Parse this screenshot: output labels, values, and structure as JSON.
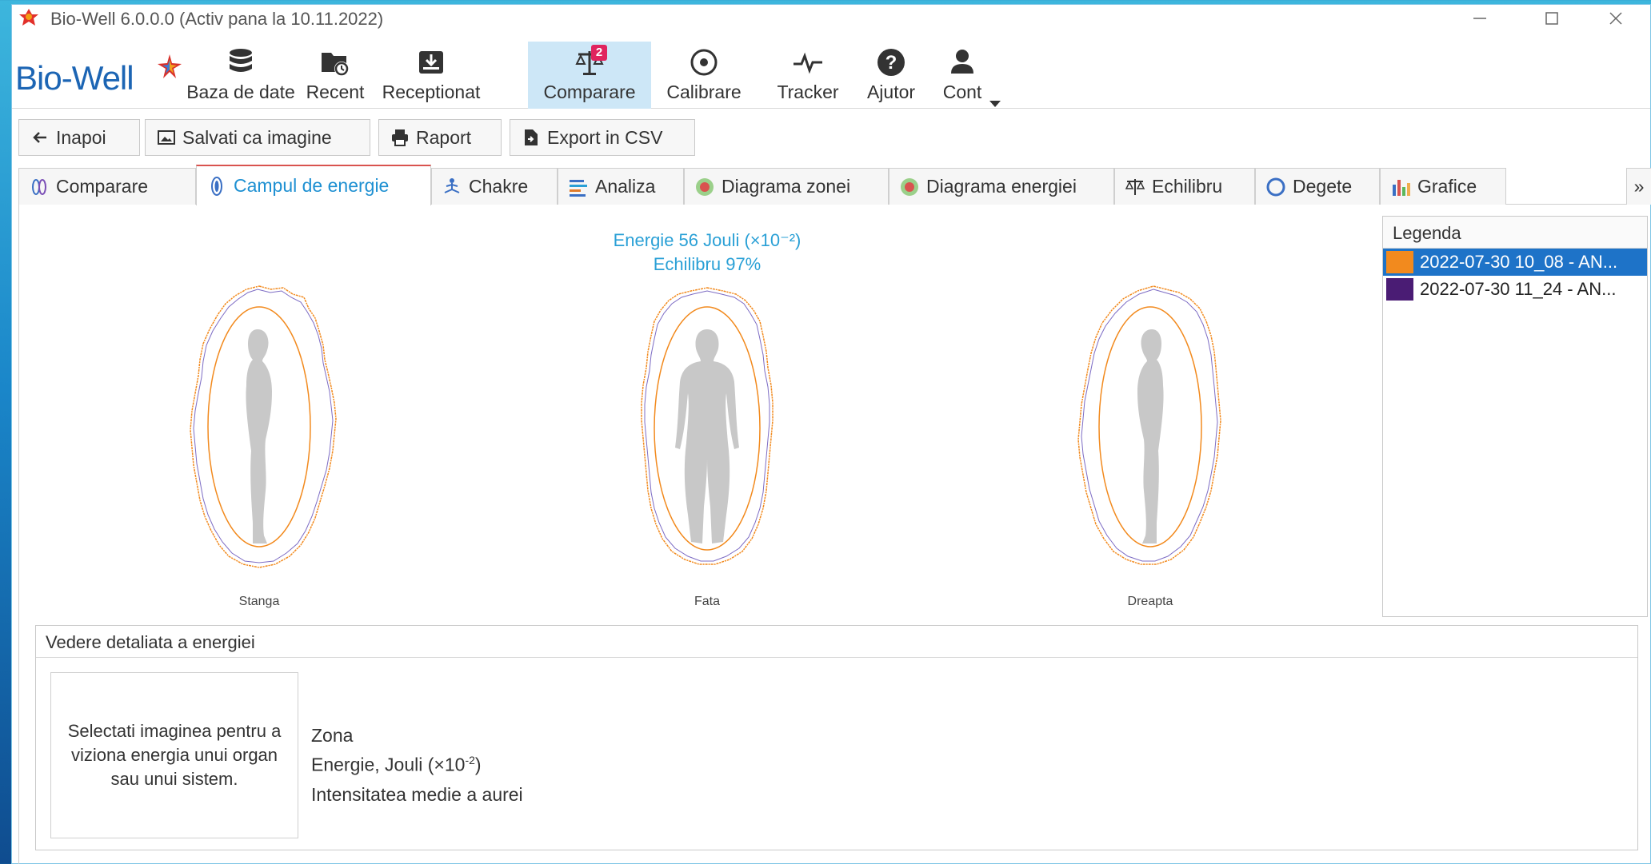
{
  "window": {
    "title": "Bio-Well 6.0.0.0 (Activ pana la 10.11.2022)"
  },
  "logo": {
    "text": "Bio-Well"
  },
  "toolbar": {
    "items": [
      {
        "label": "Baza de date",
        "icon": "database-icon"
      },
      {
        "label": "Recent",
        "icon": "folder-clock-icon"
      },
      {
        "label": "Receptionat",
        "icon": "inbox-download-icon"
      },
      {
        "label": "Comparare",
        "icon": "scales-icon",
        "badge": "2",
        "active": true
      },
      {
        "label": "Calibrare",
        "icon": "target-icon"
      },
      {
        "label": "Tracker",
        "icon": "pulse-icon"
      },
      {
        "label": "Ajutor",
        "icon": "help-icon"
      },
      {
        "label": "Cont",
        "icon": "user-icon"
      }
    ]
  },
  "actions": {
    "back": "Inapoi",
    "save_image": "Salvati ca imagine",
    "report": "Raport",
    "export_csv": "Export in CSV"
  },
  "tabs": [
    {
      "label": "Comparare"
    },
    {
      "label": "Campul de energie",
      "active": true
    },
    {
      "label": "Chakre"
    },
    {
      "label": "Analiza"
    },
    {
      "label": "Diagrama zonei"
    },
    {
      "label": "Diagrama energiei"
    },
    {
      "label": "Echilibru"
    },
    {
      "label": "Degete"
    },
    {
      "label": "Grafice"
    }
  ],
  "tab_overflow": "»",
  "energy": {
    "line1": "Energie 56 Jouli (×10⁻²)",
    "line2": "Echilibru 97%"
  },
  "views": {
    "left": "Stanga",
    "front": "Fata",
    "right": "Dreapta"
  },
  "legend": {
    "title": "Legenda",
    "items": [
      {
        "label": "2022-07-30 10_08 - AN...",
        "color": "#f28a1e"
      },
      {
        "label": "2022-07-30 11_24 - AN...",
        "color": "#4a1c74"
      }
    ]
  },
  "detail": {
    "title": "Vedere detaliata a energiei",
    "select_hint": "Selectati imaginea pentru a viziona energia unui organ sau unui sistem.",
    "zona": "Zona",
    "energie": "Energie, Jouli (×10",
    "energie_exp": "-2",
    "energie_close": ")",
    "intensitate": "Intensitatea medie a aurei"
  },
  "colors": {
    "accent": "#1e73c8",
    "aura_a": "#f28a1e",
    "aura_b": "#7d6cc4"
  }
}
